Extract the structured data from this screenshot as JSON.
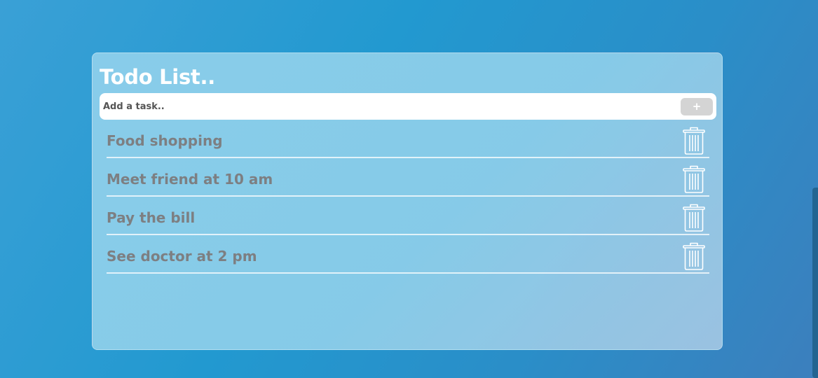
{
  "header": {
    "title": "Todo List.."
  },
  "add_task": {
    "placeholder": "Add a task..",
    "value": "",
    "button_label": "+"
  },
  "tasks": [
    {
      "text": "Food shopping",
      "action_icon": "trash-icon"
    },
    {
      "text": "Meet friend at 10 am",
      "action_icon": "trash-icon"
    },
    {
      "text": "Pay the bill",
      "action_icon": "trash-icon"
    },
    {
      "text": "See doctor at 2 pm",
      "action_icon": "trash-icon"
    }
  ],
  "colors": {
    "background": "#2299d0",
    "card": "#8ccdea",
    "title": "#ffffff",
    "task_text": "#7d7f82",
    "add_button": "#d4d4d4",
    "divider": "#ffffff"
  }
}
